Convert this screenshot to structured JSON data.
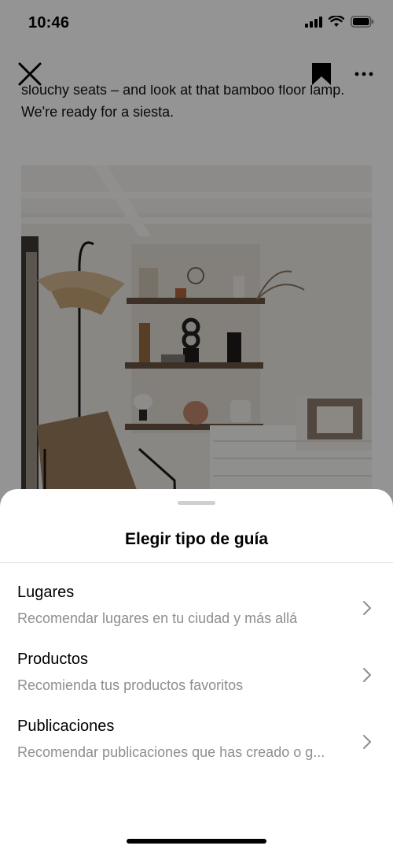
{
  "status_bar": {
    "time": "10:46"
  },
  "article": {
    "line1": "slouchy seats – and look at that bamboo floor lamp.",
    "line2": "We're ready for a siesta."
  },
  "icons": {
    "close": "close-icon",
    "bookmark": "bookmark-icon",
    "more": "more-icon",
    "chevron": "chevron-right-icon"
  },
  "sheet": {
    "title": "Elegir tipo de guía",
    "options": [
      {
        "title": "Lugares",
        "subtitle": "Recomendar lugares en tu ciudad y más allá"
      },
      {
        "title": "Productos",
        "subtitle": "Recomienda tus productos favoritos"
      },
      {
        "title": "Publicaciones",
        "subtitle": "Recomendar publicaciones que has creado o g..."
      }
    ]
  },
  "colors": {
    "overlay": "#000000",
    "secondary_text": "#8e8e8e",
    "divider": "#dbdbdb"
  }
}
